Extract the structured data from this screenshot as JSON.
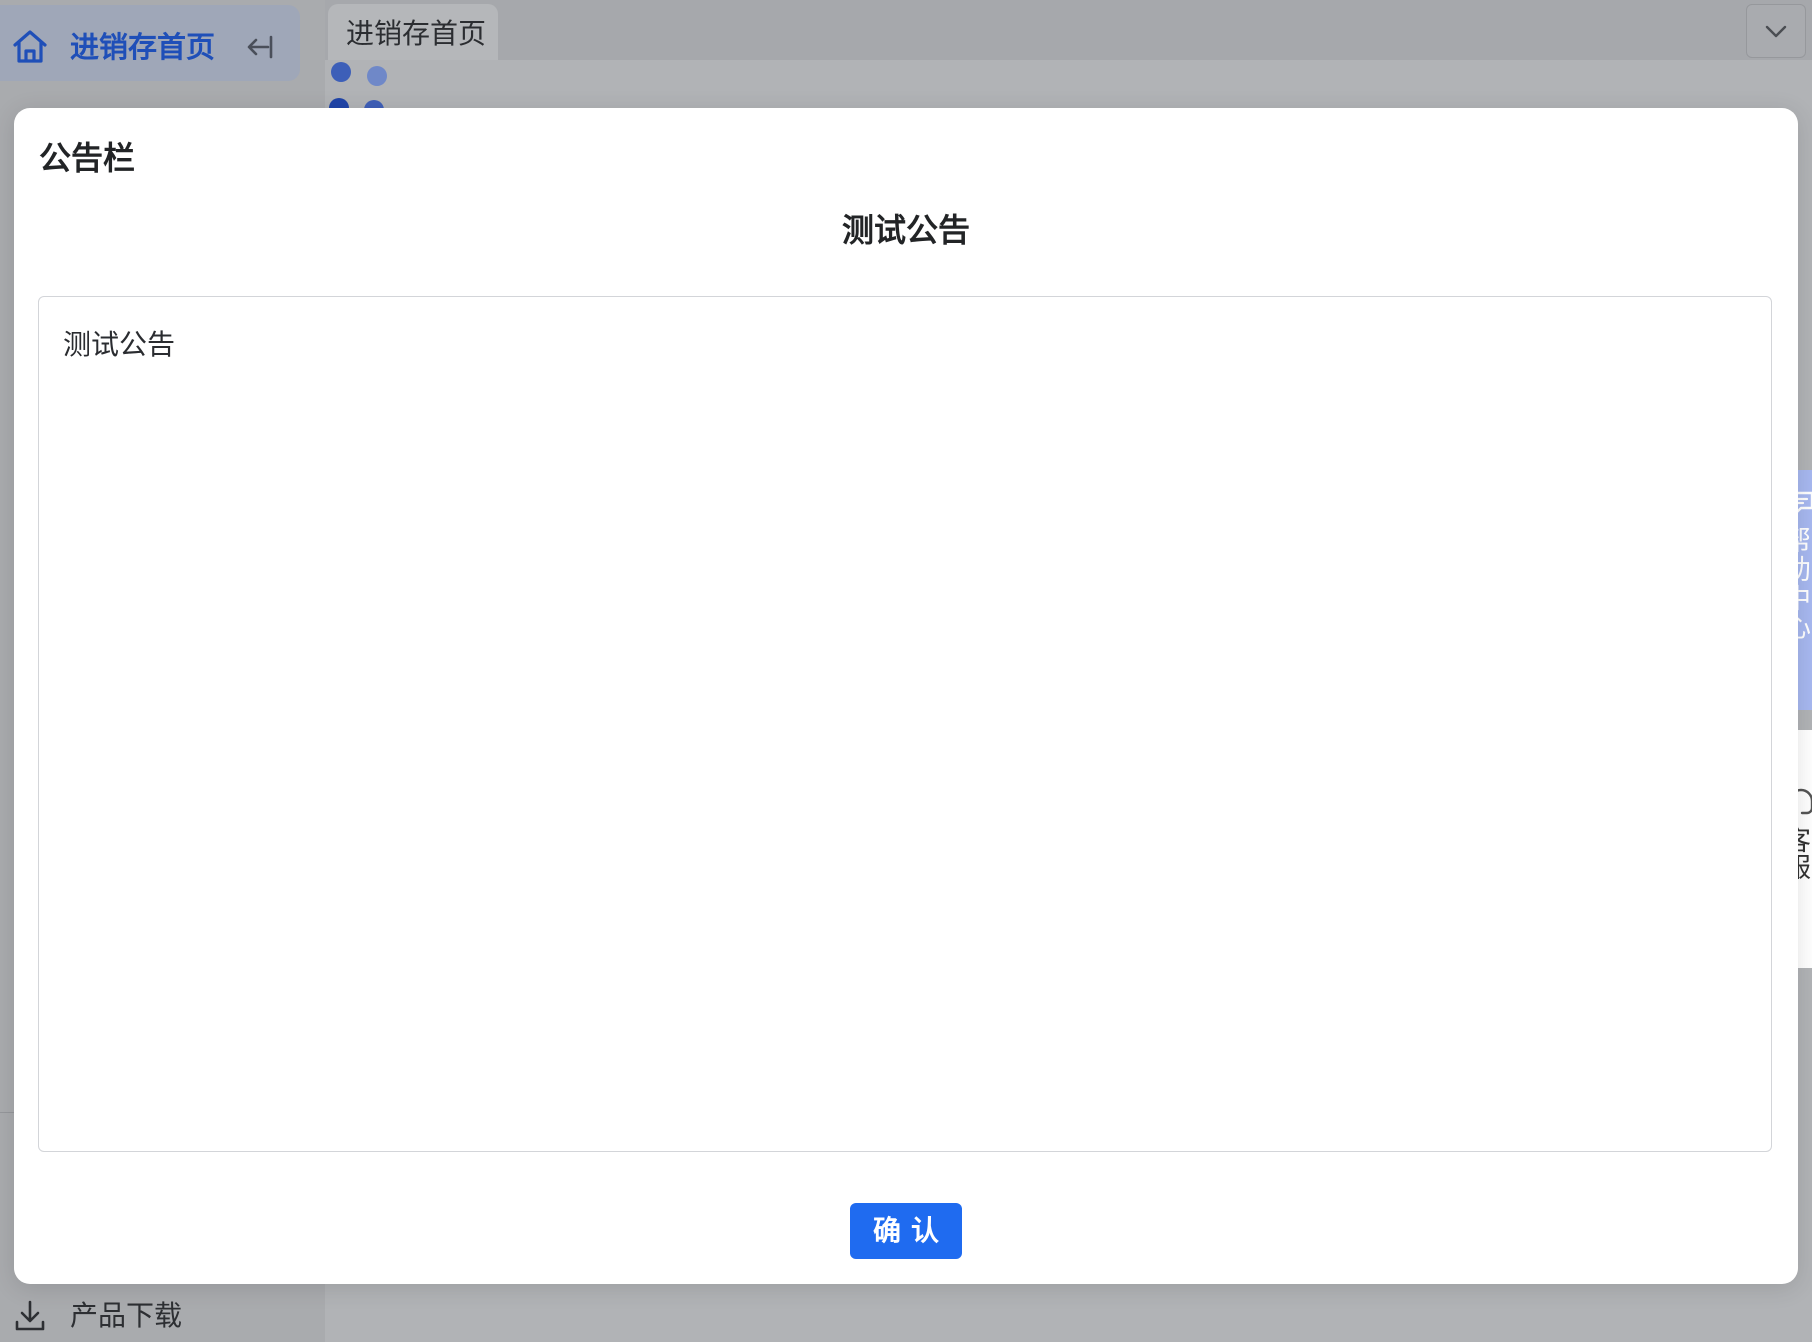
{
  "sidebar": {
    "home_label": "进销存首页",
    "download_label": "产品下载"
  },
  "tabs": {
    "active_label": "进销存首页"
  },
  "floating": {
    "help_label": "帮助中心",
    "service_label": "客服"
  },
  "modal": {
    "title": "公告栏",
    "notice_title": "测试公告",
    "notice_body": "测试公告",
    "confirm_label": "确认"
  },
  "colors": {
    "accent": "#1f6bf0",
    "help_tab": "#a7b8f0"
  },
  "icons": {
    "home": "home-icon",
    "collapse": "collapse-left-icon",
    "download": "download-icon",
    "dropdown": "chevron-down-icon",
    "help": "message-icon",
    "service": "headset-icon"
  }
}
